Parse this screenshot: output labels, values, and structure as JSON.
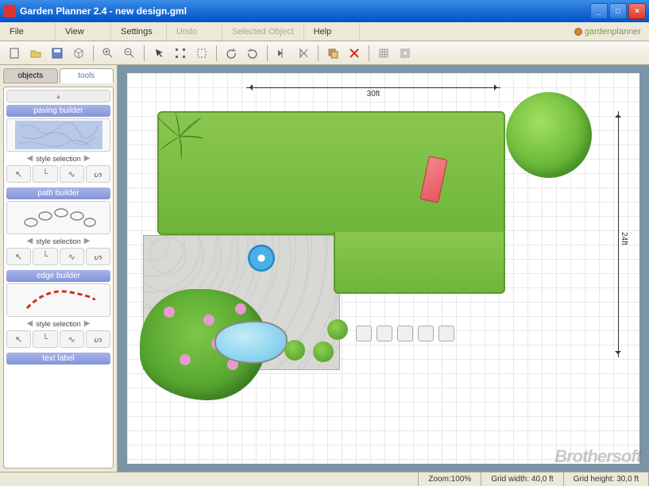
{
  "window": {
    "title": "Garden Planner 2.4 - new design.gml"
  },
  "brand": {
    "word1": "garden",
    "word2": "planner"
  },
  "menu": {
    "file": "File",
    "view": "View",
    "settings": "Settings",
    "undo": "Undo",
    "selected": "Selected Object",
    "help": "Help"
  },
  "sidebar": {
    "tab_objects": "objects",
    "tab_tools": "tools",
    "paving_head": "paving builder",
    "path_head": "path builder",
    "edge_head": "edge builder",
    "text_head": "text label",
    "style_sel": "style selection"
  },
  "design": {
    "dim_w": "30ft",
    "dim_h": "24ft"
  },
  "status": {
    "zoom_label": "Zoom:",
    "zoom_val": "100%",
    "gw_label": "Grid width:",
    "gw_val": "40,0 ft",
    "gh_label": "Grid height:",
    "gh_val": "30,0 ft"
  },
  "watermark": "Brothersoft"
}
